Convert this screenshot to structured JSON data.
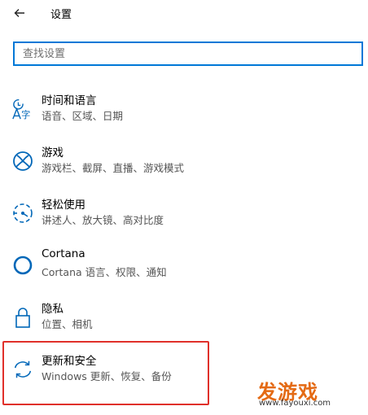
{
  "header": {
    "title": "设置"
  },
  "search": {
    "placeholder": "查找设置"
  },
  "items": [
    {
      "name": "时间和语言",
      "desc": "语音、区域、日期",
      "icon": "time-language-icon"
    },
    {
      "name": "游戏",
      "desc": "游戏栏、截屏、直播、游戏模式",
      "icon": "xbox-icon"
    },
    {
      "name": "轻松使用",
      "desc": "讲述人、放大镜、高对比度",
      "icon": "ease-of-access-icon"
    },
    {
      "name": "Cortana",
      "desc": "Cortana 语言、权限、通知",
      "icon": "cortana-icon"
    },
    {
      "name": "隐私",
      "desc": "位置、相机",
      "icon": "lock-icon"
    },
    {
      "name": "更新和安全",
      "desc": "Windows 更新、恢复、备份",
      "icon": "sync-icon"
    }
  ],
  "watermark": {
    "logo": "发游戏",
    "url": "www.fayouxi.com"
  },
  "colors": {
    "accent": "#0078d7",
    "highlight": "#e0302a",
    "watermark": "#e46a14"
  }
}
